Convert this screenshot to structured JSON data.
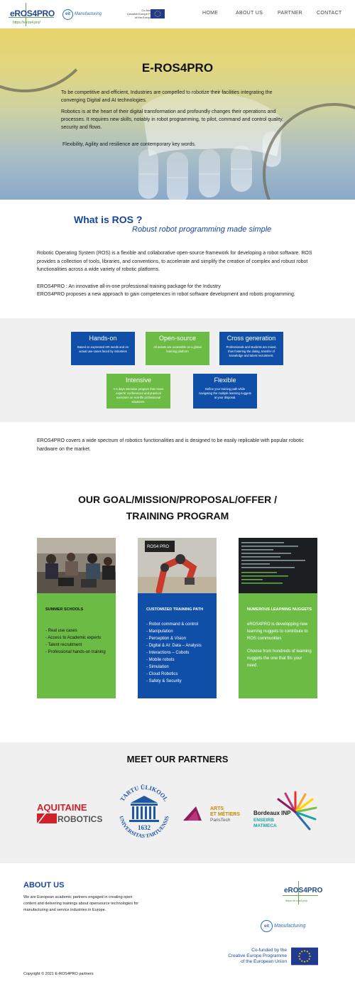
{
  "header": {
    "logo_name": "eROS4PRO",
    "logo_url": "https://e.ros4.pro/",
    "eit_logo": "eit",
    "eit_label": "Manufacturing",
    "cofund_lines": [
      "Co-funded by the",
      "Creative Europe Programme",
      "of the European Union"
    ],
    "nav": [
      "HOME",
      "ABOUT US",
      "PARTNER",
      "CONTACT"
    ]
  },
  "hero": {
    "title": "E-ROS4PRO",
    "p1": "To be competitive and efficient, Industries are compelled to  robotize their facilities integrating the converging Digital and AI technologies.",
    "p2": "Robotics is at the heart of their digital transformation and profoundly changes their operations and processes. It requires new skills, notably in robot programming, to pilot, command and control quality, security and flows.",
    "p3": "Flexibility, Agility and resilience are contemporary key words."
  },
  "what_is_ros": {
    "title": "What is ROS ?",
    "subtitle": "Robust robot programming made simple",
    "p1": "Robotic Operating System (ROS) is a flexible and collaborative open-source framework for developing a robot software. ROS provides a collection of tools, libraries, and conventions, to accelerate and simplify the creation of complex and robust robot functionalities across a wide variety of robotic platforms.",
    "p2a": "EROS4PRO : An innovative all-in-one professional training package for the Industry",
    "p2b": "EROS4PRO proposes a new approach to gain competences in robot software development and robots programming."
  },
  "features": [
    {
      "title": "Hands-on",
      "desc": "Based on expressed HR needs and on actual use-cases faced by industries"
    },
    {
      "title": "Open-source",
      "desc": "All assets are accessible on a global learning platform"
    },
    {
      "title": "Cross generation",
      "desc": "Professionals and students are mixed, thus fostering the dialog, transfer of knowledge and talent recruitment."
    },
    {
      "title": "Intensive",
      "desc": "A 5 days intensive program that mixes experts' conferences and practical exercises on real-life professional situations."
    },
    {
      "title": "Flexible",
      "desc": "Define your training path while navigating the multiple learning nuggets at your disposal."
    }
  ],
  "coverage": "EROS4PRO covers a wide spectrum of robotics functionalities and is designed to be easily replicable with popular robotic hardware on the market.",
  "goal": {
    "line1": "OUR GOAL/MISSION/PROPOSAL/OFFER /",
    "line2": "TRAINING PROGRAM"
  },
  "columns": [
    {
      "heading": "SUMMER SCHOOLS",
      "items": [
        "- Real use cases",
        "- Access to Academic experts",
        "- Talent recruitment",
        "- Professional hands-on training"
      ]
    },
    {
      "heading": "CUSTOMIZED TRAINING PATH",
      "items": [
        "- Robot command & control",
        "- Manipulation",
        "- Perception & Vision",
        "- Digital & AI: Data – Analysis",
        "- Interactions – Cobots",
        "- Mobile robots",
        "- Simulation",
        "- Cloud Robotics",
        "- Safety & Security"
      ]
    },
    {
      "heading": "NUMEROUS LEARNING NUGGETS",
      "items": [
        "eROS4PRO is developping new learning nuggets to contribute to ROS communities",
        "Choose from hundreds of learning nuggets the one that fits your need."
      ]
    }
  ],
  "col2_image_label": "ROS4 PRO",
  "partners": {
    "title": "MEET OUR PARTNERS",
    "aquitaine": [
      "AQUITAINE",
      "ROBOTICS"
    ],
    "tartu": {
      "top": "TARTU ÜLIKOOL",
      "bottom": "UNIVERSITAS TARTUENSIS",
      "year": "1632"
    },
    "arts": [
      "ARTS",
      "ET MÉTIERS",
      "ParisTech"
    ],
    "bordeaux": [
      "Bordeaux INP",
      "ENSEIRB",
      "MATMECA"
    ]
  },
  "footer": {
    "about_title": "ABOUT US",
    "about_text": "We are European academic partners engaged in creating open content and delivering trainings about opensource technologies for manufacturing and service industries in Europe.",
    "cofund_lines": [
      "Co-funded by the",
      "Creative Europe Programme",
      "of the European Union"
    ],
    "copyright": "Copyright © 2021 E-ROS4PRO partners"
  },
  "colors": {
    "blue": "#0f4fa8",
    "green": "#6cbb45",
    "title_blue": "#17459c"
  }
}
